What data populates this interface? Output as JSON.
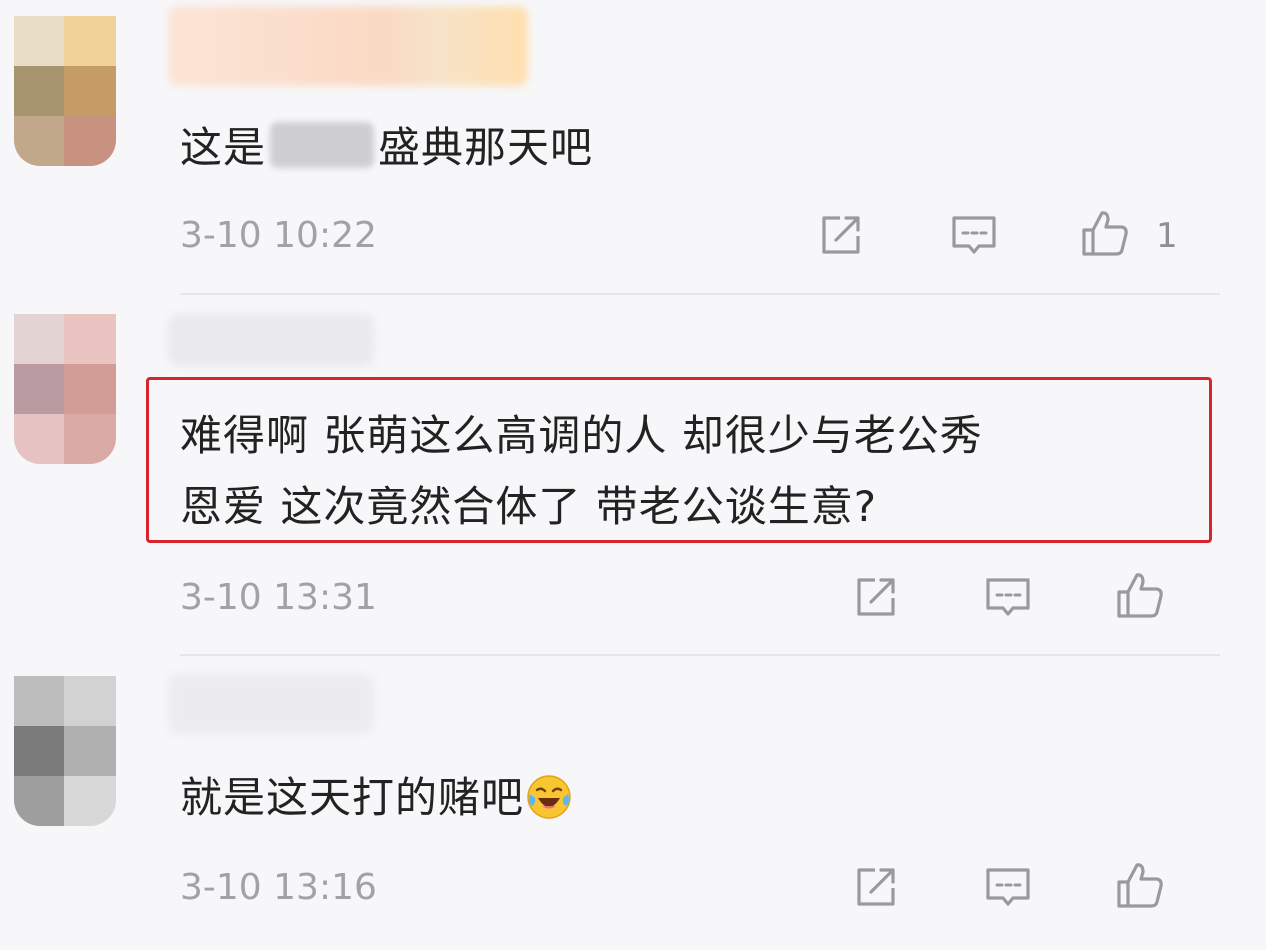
{
  "comments": [
    {
      "text_before": "这是",
      "text_after": "盛典那天吧",
      "timestamp": "3-10 10:22",
      "like_count": "1",
      "actions": [
        "share-icon",
        "comment-icon",
        "like-icon"
      ]
    },
    {
      "line1": "难得啊  张萌这么高调的人  却很少与老公秀",
      "line2": "恩爱  这次竟然合体了  带老公谈生意?",
      "timestamp": "3-10 13:31",
      "like_count": "",
      "highlighted": true,
      "highlight_color": "#d8252b",
      "actions": [
        "share-icon",
        "comment-icon",
        "like-icon"
      ]
    },
    {
      "text": "就是这天打的赌吧",
      "emoji": "laughing-crying-emoji",
      "timestamp": "3-10 13:16",
      "like_count": "",
      "actions": [
        "share-icon",
        "comment-icon",
        "like-icon"
      ]
    }
  ],
  "colors": {
    "background": "#f7f7f9",
    "text": "#222222",
    "meta": "#a2a2a6",
    "icon": "#9a9a9e",
    "highlight": "#d8252b"
  }
}
